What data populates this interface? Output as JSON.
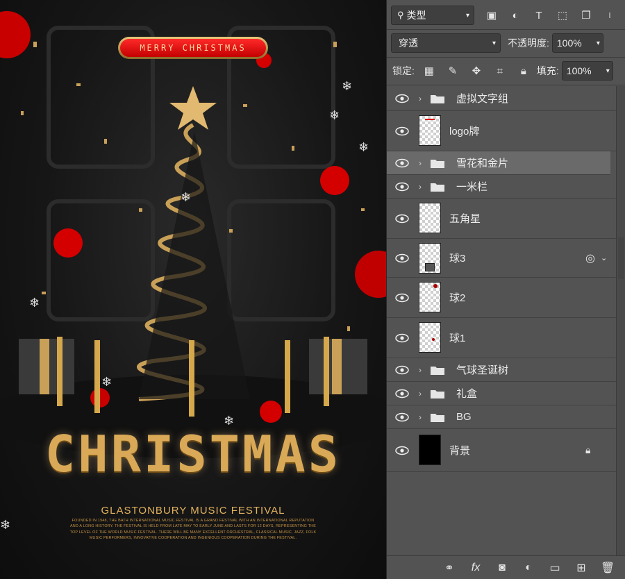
{
  "poster": {
    "badge_text": "MERRY CHRISTMAS",
    "title": "CHRISTMAS",
    "festival": "GLASTONBURY MUSIC FESTIVAL",
    "blurb": "FOUNDED IN 1948, THE BATH INTERNATIONAL MUSIC FESTIVAL IS A GRAND FESTIVAL WITH AN INTERNATIONAL REPUTATION AND A LONG HISTORY. THE FESTIVAL IS HELD FROM LATE MAY TO EARLY JUNE AND LASTS FOR 12 DAYS, REPRESENTING THE TOP LEVEL OF THE WORLD MUSIC FESTIVAL. THERE WILL BE MANY EXCELLENT ORCHESTRAL, CLASSICAL MUSIC, JAZZ, FOLK MUSIC PERFORMERS, INNOVATIVE COOPERATION AND INGENIOUS COOPERATION DURING THE FESTIVAL."
  },
  "panel": {
    "filter_label": "类型",
    "blend_mode": "穿透",
    "opacity_label": "不透明度:",
    "opacity_value": "100%",
    "lock_label": "锁定:",
    "fill_label": "填充:",
    "fill_value": "100%",
    "layers": [
      {
        "name": "虚拟文字组",
        "type": "group"
      },
      {
        "name": "logo牌",
        "type": "layer"
      },
      {
        "name": "雪花和金片",
        "type": "group",
        "selected": true
      },
      {
        "name": "一米栏",
        "type": "group"
      },
      {
        "name": "五角星",
        "type": "layer"
      },
      {
        "name": "球3",
        "type": "layer"
      },
      {
        "name": "球2",
        "type": "layer"
      },
      {
        "name": "球1",
        "type": "layer"
      },
      {
        "name": "气球圣诞树",
        "type": "group"
      },
      {
        "name": "礼盒",
        "type": "group"
      },
      {
        "name": "BG",
        "type": "group"
      },
      {
        "name": "背景",
        "type": "background"
      }
    ]
  },
  "colors": {
    "panel_bg": "#535353",
    "gold": "#d9a957",
    "red": "#e00000"
  }
}
